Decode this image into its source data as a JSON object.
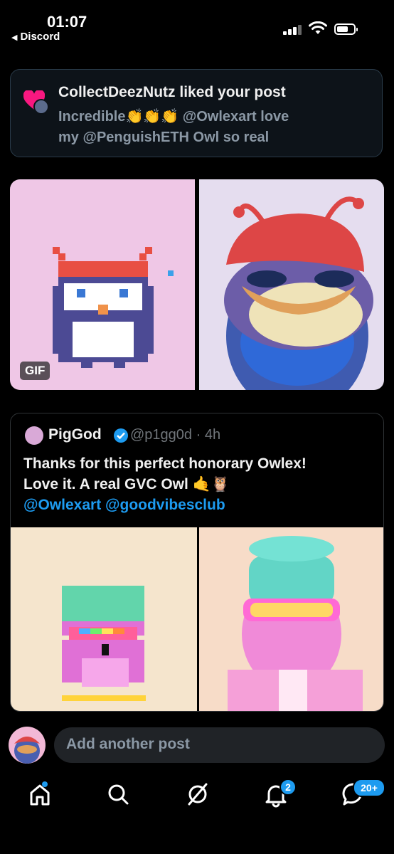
{
  "status": {
    "time": "01:07",
    "back_label": "Discord",
    "back_arrow": "◀"
  },
  "notification": {
    "title": "CollectDeezNutz liked your post",
    "body_line1": "Incredible👏👏👏 @Owlexart  love",
    "body_line2": "my @PenguishETH Owl so real"
  },
  "media": {
    "gif_badge": "GIF"
  },
  "quote": {
    "name": "PigGod",
    "handle": "@p1gg0d · 4h",
    "text_line1": "Thanks for this perfect honorary Owlex!",
    "text_line2": "Love it. A real GVC Owl 🤙🦉",
    "mentions": "@Owlexart @goodvibesclub"
  },
  "composer": {
    "placeholder": "Add another post"
  },
  "tabs": {
    "notifications_badge": "2",
    "messages_badge": "20+"
  },
  "colors": {
    "accent": "#1d9bf0",
    "card_border": "#2a3b4a",
    "muted_text": "#8b98a5"
  }
}
